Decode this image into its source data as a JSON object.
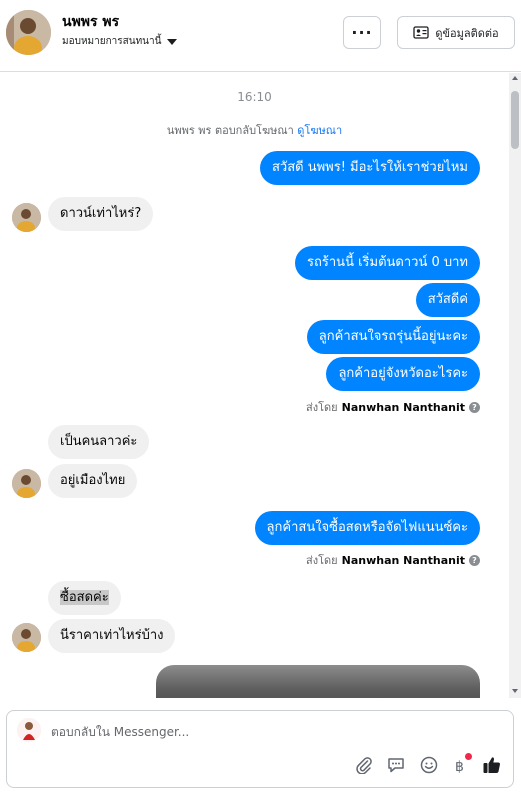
{
  "header": {
    "name": "นพพร พร",
    "assign_label": "มอบหมายการสนทนานี้",
    "more_label": "···",
    "info_button_label": "ดูข้อมูลติดต่อ"
  },
  "chat": {
    "timestamp": "16:10",
    "system_note": {
      "text": "นพพร พร ตอบกลับโฆษณา",
      "link": "ดูโฆษณา"
    },
    "messages": [
      {
        "side": "out",
        "text": "สวัสดี นพพร! มีอะไรให้เราช่วยไหม"
      },
      {
        "side": "in",
        "text": "ดาวน์เท่าไหร่?"
      },
      {
        "side": "out",
        "text": "รถร้านนี้ เริ่มต้นดาวน์ 0 บาท"
      },
      {
        "side": "out",
        "text": "สวัสดีค่"
      },
      {
        "side": "out",
        "text": "ลูกค้าสนใจรถรุ่นนี้อยู่นะคะ"
      },
      {
        "side": "out",
        "text": "ลูกค้าอยู่จังหวัดอะไรคะ"
      },
      {
        "side": "in",
        "text": "เป็นคนลาวค่ะ"
      },
      {
        "side": "in",
        "text": "อยู่เมืองไทย"
      },
      {
        "side": "out",
        "text": "ลูกค้าสนใจซื้อสดหรือจัดไฟแนนซ์คะ"
      },
      {
        "side": "in",
        "text": "ซื้อสดค่ะ"
      },
      {
        "side": "in",
        "text": "นีราคาเท่าไหร่บ้าง"
      }
    ],
    "sent_by": [
      {
        "prefix": "ส่งโดย",
        "name": "Nanwhan Nanthanit"
      },
      {
        "prefix": "ส่งโดย",
        "name": "Nanwhan Nanthanit"
      }
    ]
  },
  "composer": {
    "placeholder": "ตอบกลับใน Messenger...",
    "tools": [
      "paperclip-icon",
      "saved-reply-icon",
      "emoji-icon",
      "baht-payment-icon",
      "like-icon"
    ]
  },
  "colors": {
    "outgoing_bubble": "#0084ff",
    "incoming_bubble": "#f0f0f0",
    "link": "#1877f2",
    "like": "#1c1e21",
    "notification_dot": "#f02849"
  }
}
